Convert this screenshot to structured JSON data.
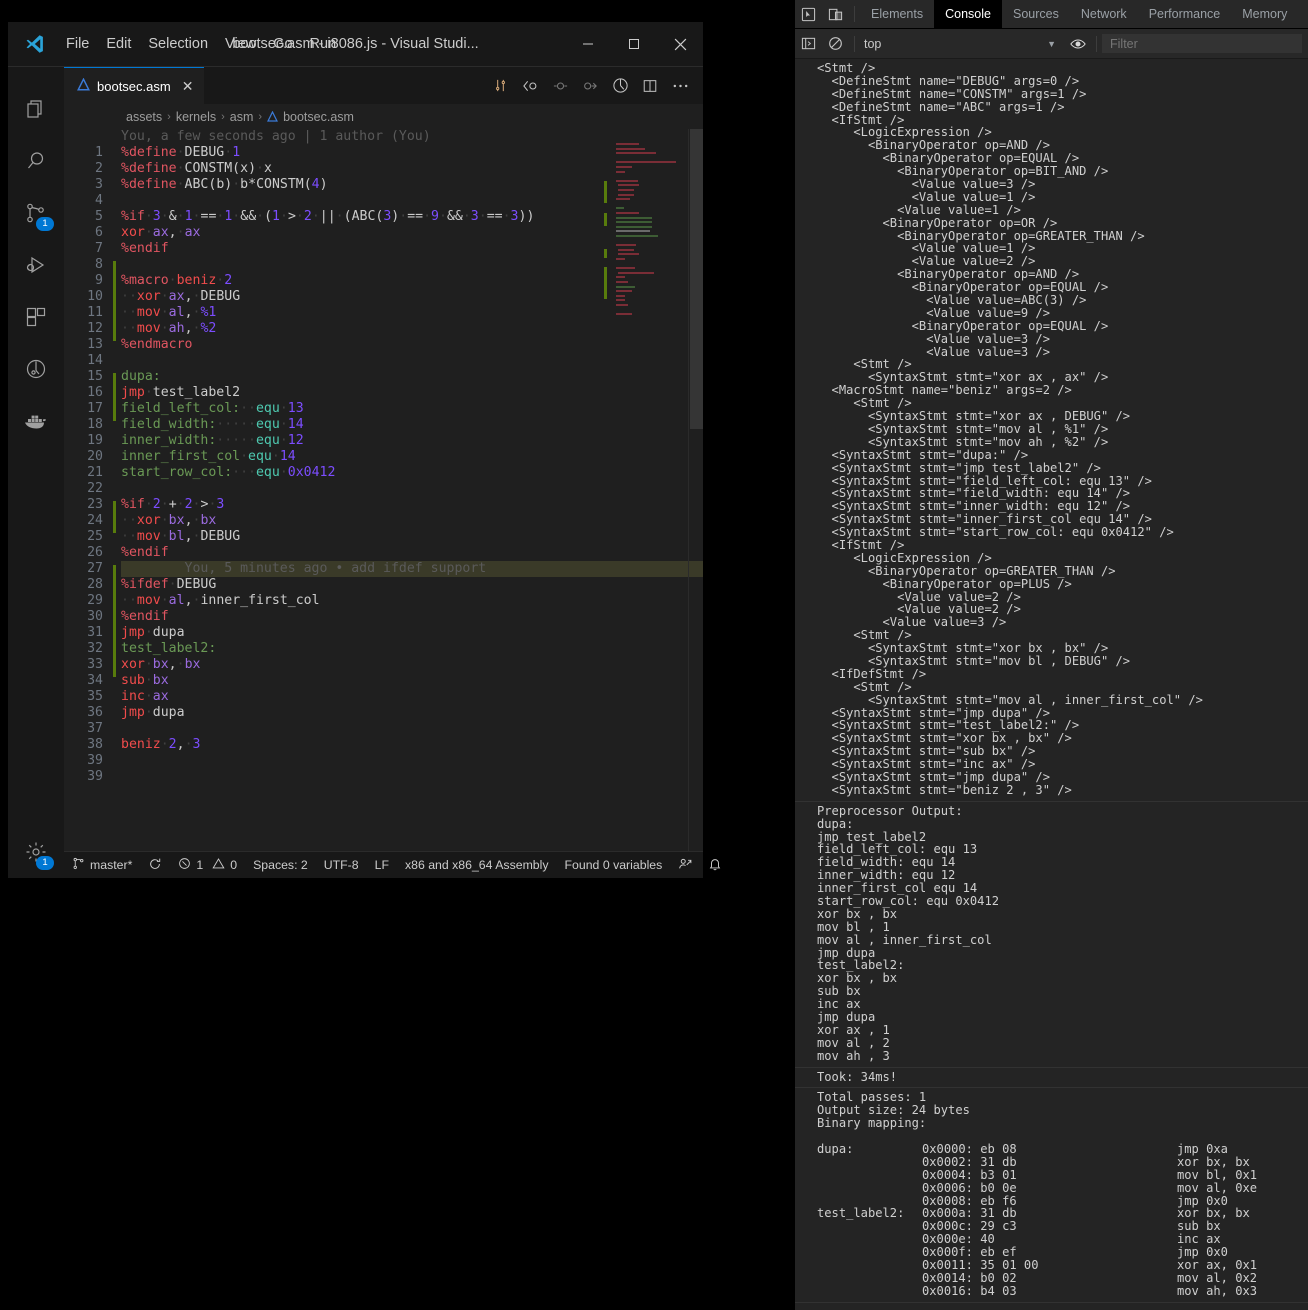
{
  "vscode": {
    "title": "bootsec.asm - i8086.js - Visual Studi...",
    "menu": [
      "File",
      "Edit",
      "Selection",
      "View",
      "Go",
      "Run"
    ],
    "window_controls": {
      "minimize": "—",
      "maximize": "☐",
      "close": "✕"
    },
    "activity_items": [
      {
        "name": "explorer",
        "badge": ""
      },
      {
        "name": "search",
        "badge": ""
      },
      {
        "name": "source-control",
        "badge": "1"
      },
      {
        "name": "run-and-debug",
        "badge": ""
      },
      {
        "name": "extensions",
        "badge": ""
      },
      {
        "name": "testing",
        "badge": ""
      },
      {
        "name": "docker",
        "badge": ""
      }
    ],
    "tab": {
      "label": "bootsec.asm",
      "close": "✕"
    },
    "breadcrumb": [
      "assets",
      "kernels",
      "asm",
      "bootsec.asm"
    ],
    "breadcrumb_sep": "›",
    "blame_header": "You, a few seconds ago | 1 author (You)",
    "blame_inline": "You, 5 minutes ago • add ifdef support",
    "code_lines": [
      "%define DEBUG 1",
      "%define CONSTM(x) x",
      "%define ABC(b) b*CONSTM(4)",
      "",
      "%if 3 & 1 == 1 && (1 > 2 || (ABC(3) == 9 && 3 == 3))",
      "xor ax, ax",
      "%endif",
      "",
      "%macro beniz 2",
      "  xor ax, DEBUG",
      "  mov al, %1",
      "  mov ah, %2",
      "%endmacro",
      "",
      "dupa:",
      "jmp test_label2",
      "field_left_col:  equ 13",
      "field_width:     equ 14",
      "inner_width:     equ 12",
      "inner_first_col equ 14",
      "start_row_col:   equ 0x0412",
      "",
      "%if 2 + 2 > 3",
      "  xor bx, bx",
      "  mov bl, DEBUG",
      "%endif",
      "",
      "%ifdef DEBUG",
      "  mov al, inner_first_col",
      "%endif",
      "jmp dupa",
      "test_label2:",
      "xor bx, bx",
      "sub bx",
      "inc ax",
      "jmp dupa",
      "",
      "beniz 2, 3",
      ""
    ],
    "last_line_number": 39,
    "statusbar": {
      "branch": "master*",
      "sync_icon": "sync-icon",
      "errors": "1",
      "warnings": "0",
      "spaces": "Spaces: 2",
      "encoding": "UTF-8",
      "eol": "LF",
      "language": "x86 and x86_64 Assembly",
      "variables": "Found 0 variables",
      "remote_icon": "feedback-icon",
      "bell_icon": "bell-icon"
    }
  },
  "devtools": {
    "tabs": [
      "Elements",
      "Console",
      "Sources",
      "Network",
      "Performance",
      "Memory"
    ],
    "active_tab": "Console",
    "context": "top",
    "filter_placeholder": "Filter",
    "icons": [
      "inspect-icon",
      "device-toolbar-icon",
      "sidebar-toggle-icon",
      "clear-console-icon",
      "eye-icon"
    ],
    "console_messages": [
      {
        "name": "ast-dump",
        "lines": [
          "<Stmt />",
          "  <DefineStmt name=\"DEBUG\" args=0 />",
          "  <DefineStmt name=\"CONSTM\" args=1 />",
          "  <DefineStmt name=\"ABC\" args=1 />",
          "  <IfStmt />",
          "     <LogicExpression />",
          "       <BinaryOperator op=AND />",
          "         <BinaryOperator op=EQUAL />",
          "           <BinaryOperator op=BIT_AND />",
          "             <Value value=3 />",
          "             <Value value=1 />",
          "           <Value value=1 />",
          "         <BinaryOperator op=OR />",
          "           <BinaryOperator op=GREATER_THAN />",
          "             <Value value=1 />",
          "             <Value value=2 />",
          "           <BinaryOperator op=AND />",
          "             <BinaryOperator op=EQUAL />",
          "               <Value value=ABC(3) />",
          "               <Value value=9 />",
          "             <BinaryOperator op=EQUAL />",
          "               <Value value=3 />",
          "               <Value value=3 />",
          "     <Stmt />",
          "       <SyntaxStmt stmt=\"xor ax , ax\" />",
          "  <MacroStmt name=\"beniz\" args=2 />",
          "     <Stmt />",
          "       <SyntaxStmt stmt=\"xor ax , DEBUG\" />",
          "       <SyntaxStmt stmt=\"mov al , %1\" />",
          "       <SyntaxStmt stmt=\"mov ah , %2\" />",
          "  <SyntaxStmt stmt=\"dupa:\" />",
          "  <SyntaxStmt stmt=\"jmp test_label2\" />",
          "  <SyntaxStmt stmt=\"field_left_col: equ 13\" />",
          "  <SyntaxStmt stmt=\"field_width: equ 14\" />",
          "  <SyntaxStmt stmt=\"inner_width: equ 12\" />",
          "  <SyntaxStmt stmt=\"inner_first_col equ 14\" />",
          "  <SyntaxStmt stmt=\"start_row_col: equ 0x0412\" />",
          "  <IfStmt />",
          "     <LogicExpression />",
          "       <BinaryOperator op=GREATER_THAN />",
          "         <BinaryOperator op=PLUS />",
          "           <Value value=2 />",
          "           <Value value=2 />",
          "         <Value value=3 />",
          "     <Stmt />",
          "       <SyntaxStmt stmt=\"xor bx , bx\" />",
          "       <SyntaxStmt stmt=\"mov bl , DEBUG\" />",
          "  <IfDefStmt />",
          "     <Stmt />",
          "       <SyntaxStmt stmt=\"mov al , inner_first_col\" />",
          "  <SyntaxStmt stmt=\"jmp dupa\" />",
          "  <SyntaxStmt stmt=\"test_label2:\" />",
          "  <SyntaxStmt stmt=\"xor bx , bx\" />",
          "  <SyntaxStmt stmt=\"sub bx\" />",
          "  <SyntaxStmt stmt=\"inc ax\" />",
          "  <SyntaxStmt stmt=\"jmp dupa\" />",
          "  <SyntaxStmt stmt=\"beniz 2 , 3\" />"
        ]
      },
      {
        "name": "preprocessor-output",
        "lines": [
          "Preprocessor Output:",
          "dupa:",
          "jmp test_label2",
          "field_left_col: equ 13",
          "field_width: equ 14",
          "inner_width: equ 12",
          "inner_first_col equ 14",
          "start_row_col: equ 0x0412",
          "xor bx , bx",
          "mov bl , 1",
          "mov al , inner_first_col",
          "jmp dupa",
          "test_label2:",
          "xor bx , bx",
          "sub bx",
          "inc ax",
          "jmp dupa",
          "xor ax , 1",
          "mov al , 2",
          "mov ah , 3"
        ]
      },
      {
        "name": "timing",
        "lines": [
          "Took: 34ms!"
        ]
      },
      {
        "name": "assembler-summary",
        "lines": [
          "Total passes: 1",
          "Output size: 24 bytes",
          "Binary mapping:",
          ""
        ]
      }
    ],
    "binary_mapping": {
      "rows": [
        {
          "label": "dupa:",
          "addr": "0x0000: eb 08",
          "asm": "jmp 0xa"
        },
        {
          "label": "",
          "addr": "0x0002: 31 db",
          "asm": "xor bx, bx"
        },
        {
          "label": "",
          "addr": "0x0004: b3 01",
          "asm": "mov bl, 0x1"
        },
        {
          "label": "",
          "addr": "0x0006: b0 0e",
          "asm": "mov al, 0xe"
        },
        {
          "label": "",
          "addr": "0x0008: eb f6",
          "asm": "jmp 0x0"
        },
        {
          "label": "test_label2:",
          "addr": "0x000a: 31 db",
          "asm": "xor bx, bx"
        },
        {
          "label": "",
          "addr": "0x000c: 29 c3",
          "asm": "sub bx"
        },
        {
          "label": "",
          "addr": "0x000e: 40",
          "asm": "inc ax"
        },
        {
          "label": "",
          "addr": "0x000f: eb ef",
          "asm": "jmp 0x0"
        },
        {
          "label": "",
          "addr": "0x0011: 35 01 00",
          "asm": "xor ax, 0x1"
        },
        {
          "label": "",
          "addr": "0x0014: b0 02",
          "asm": "mov al, 0x2"
        },
        {
          "label": "",
          "addr": "0x0016: b4 03",
          "asm": "mov ah, 0x3"
        }
      ]
    }
  },
  "colors": {
    "accent": "#0078d4",
    "editor_bg": "#1f1f1f",
    "chrome_bg": "#181818",
    "devtools_bg": "#242424",
    "git_added": "#587c0c",
    "keyword_red": "#f14c4c",
    "label_green": "#6a9955",
    "register_purple": "#9b6bdf",
    "number_purple": "#7c4dff"
  }
}
